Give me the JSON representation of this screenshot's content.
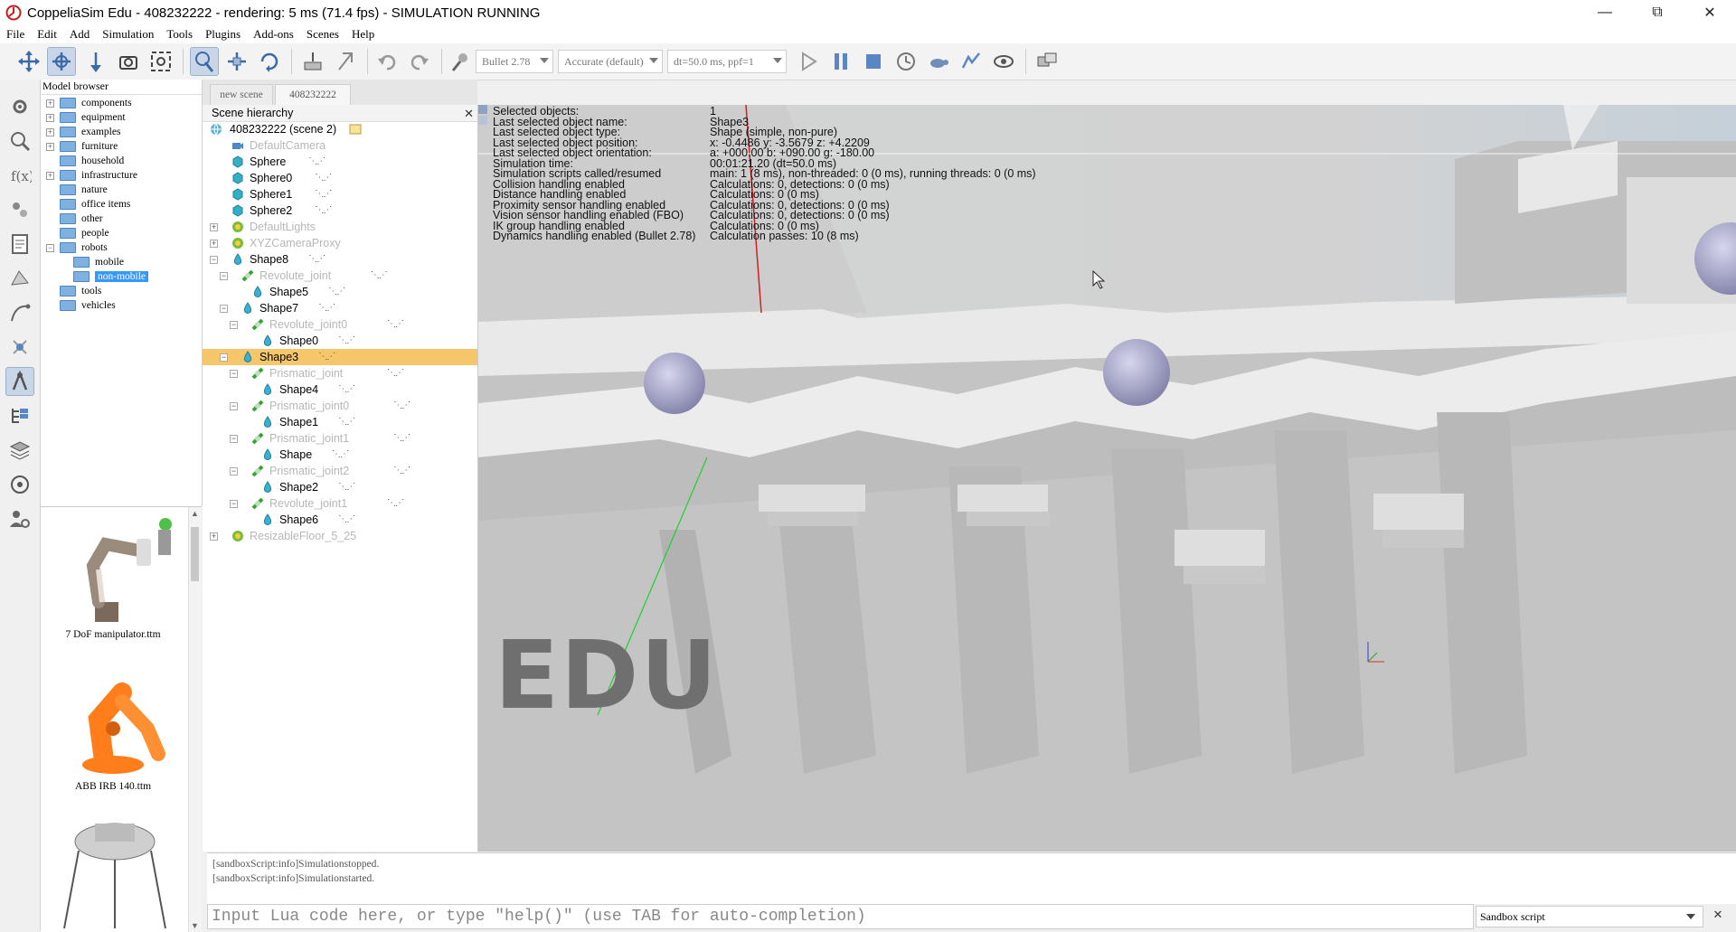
{
  "window": {
    "title": "CoppeliaSim Edu - 408232222 - rendering: 5 ms (71.4 fps) - SIMULATION RUNNING",
    "controls": [
      "minimize",
      "restore",
      "close"
    ]
  },
  "menu": [
    "File",
    "Edit",
    "Add",
    "Simulation",
    "Tools",
    "Plugins",
    "Add-ons",
    "Scenes",
    "Help"
  ],
  "toolbar": {
    "engine": "Bullet 2.78",
    "accuracy": "Accurate (default)",
    "timestep": "dt=50.0 ms, ppf=1"
  },
  "model_browser": {
    "title": "Model browser",
    "items": [
      {
        "label": "components",
        "expandable": true
      },
      {
        "label": "equipment",
        "expandable": true
      },
      {
        "label": "examples",
        "expandable": true
      },
      {
        "label": "furniture",
        "expandable": true
      },
      {
        "label": "household",
        "expandable": false
      },
      {
        "label": "infrastructure",
        "expandable": true
      },
      {
        "label": "nature",
        "expandable": false
      },
      {
        "label": "office items",
        "expandable": false
      },
      {
        "label": "other",
        "expandable": false
      },
      {
        "label": "people",
        "expandable": false
      },
      {
        "label": "robots",
        "expandable": true
      },
      {
        "label": "mobile",
        "expandable": false
      },
      {
        "label": "non-mobile",
        "expandable": false
      },
      {
        "label": "tools",
        "expandable": false
      },
      {
        "label": "vehicles",
        "expandable": false
      }
    ],
    "thumbnails": [
      "7 DoF manipulator.ttm",
      "ABB IRB 140.ttm"
    ]
  },
  "scene_tabs": [
    "new scene",
    "408232222"
  ],
  "hierarchy": {
    "title": "Scene hierarchy",
    "root": "408232222 (scene 2)",
    "rows": [
      {
        "label": "DefaultCamera",
        "dim": true
      },
      {
        "label": "Sphere",
        "dim": false
      },
      {
        "label": "Sphere0",
        "dim": false
      },
      {
        "label": "Sphere1",
        "dim": false
      },
      {
        "label": "Sphere2",
        "dim": false
      },
      {
        "label": "DefaultLights",
        "dim": true
      },
      {
        "label": "XYZCameraProxy",
        "dim": true
      },
      {
        "label": "Shape8",
        "dim": false
      },
      {
        "label": "Revolute_joint",
        "dim": true
      },
      {
        "label": "Shape5",
        "dim": false
      },
      {
        "label": "Shape7",
        "dim": false
      },
      {
        "label": "Revolute_joint0",
        "dim": true
      },
      {
        "label": "Shape0",
        "dim": false
      },
      {
        "label": "Shape3",
        "dim": false
      },
      {
        "label": "Prismatic_joint",
        "dim": true
      },
      {
        "label": "Shape4",
        "dim": false
      },
      {
        "label": "Prismatic_joint0",
        "dim": true
      },
      {
        "label": "Shape1",
        "dim": false
      },
      {
        "label": "Prismatic_joint1",
        "dim": true
      },
      {
        "label": "Shape",
        "dim": false
      },
      {
        "label": "Prismatic_joint2",
        "dim": true
      },
      {
        "label": "Shape2",
        "dim": false
      },
      {
        "label": "Revolute_joint1",
        "dim": true
      },
      {
        "label": "Shape6",
        "dim": false
      },
      {
        "label": "ResizableFloor_5_25",
        "dim": true
      }
    ]
  },
  "info_overlay": {
    "labels": [
      "Selected objects:",
      "Last selected object name:",
      "Last selected object type:",
      "Last selected object position:",
      "Last selected object orientation:",
      "Simulation time:",
      "Simulation scripts called/resumed",
      "Collision handling enabled",
      "Distance handling enabled",
      "Proximity sensor handling enabled",
      "Vision sensor handling enabled (FBO)",
      "IK group handling enabled",
      "Dynamics handling enabled (Bullet 2.78)"
    ],
    "values": [
      "1",
      "Shape3",
      "Shape (simple, non-pure)",
      "x: -0.4486    y: -3.5679    z: +4.2209",
      "a: +000.00    b: +090.00    g: -180.00",
      "00:01:21.20 (dt=50.0 ms)",
      "main: 1 (8 ms), non-threaded: 0 (0 ms), running threads: 0 (0 ms)",
      "Calculations: 0, detections: 0 (0 ms)",
      "Calculations: 0 (0 ms)",
      "Calculations: 0, detections: 0 (0 ms)",
      "Calculations: 0, detections: 0 (0 ms)",
      "Calculations: 0 (0 ms)",
      "Calculation passes: 10 (8 ms)"
    ]
  },
  "watermark": "EDU",
  "console": {
    "lines": [
      "[sandboxScript:info]Simulationstopped.",
      "[sandboxScript:info]Simulationstarted."
    ],
    "input_placeholder": "Input Lua code here, or type \"help()\" (use TAB for auto-completion)",
    "script_select": "Sandbox script"
  },
  "colors": {
    "selection": "#f5c66a",
    "browser_selection": "#3399ff",
    "scene_gray": "#d0d0d0"
  }
}
